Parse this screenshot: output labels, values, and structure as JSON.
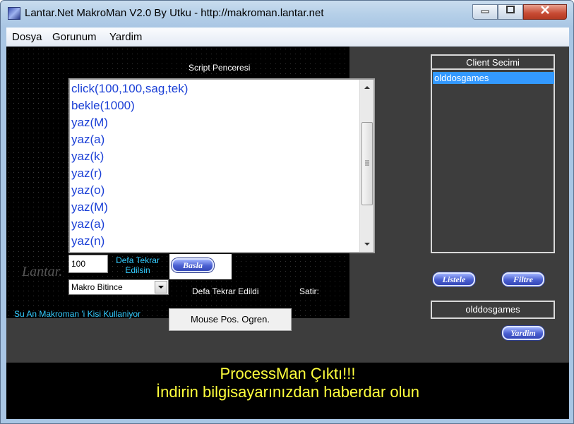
{
  "window": {
    "title": "Lantar.Net MakroMan V2.0 By Utku - http://makroman.lantar.net"
  },
  "menu": [
    "Dosya",
    "Gorunum",
    "Yardim"
  ],
  "script": {
    "heading": "Script Penceresi",
    "lines": [
      "click(100,100,sag,tek)",
      "bekle(1000)",
      "yaz(M)",
      "yaz(a)",
      "yaz(k)",
      "yaz(r)",
      "yaz(o)",
      "yaz(M)",
      "yaz(a)",
      "yaz(n)"
    ]
  },
  "controls": {
    "repeat_value": "100",
    "repeat_label_1": "Defa Tekrar",
    "repeat_label_2": "Edilsin",
    "start_button": "Basla",
    "after_macro_select": "Makro Bitince",
    "repeated_label": "Defa Tekrar Edildi",
    "line_label": "Satir:",
    "users_label": "Su An Makroman 'i Kisi Kullaniyor",
    "mouse_button": "Mouse Pos. Ogren.",
    "watermark": "Lantar."
  },
  "client": {
    "heading": "Client Secimi",
    "selected": "olddosgames",
    "list_button": "Listele",
    "filter_button": "Filtre",
    "current": "olddosgames",
    "help_button": "Yardim"
  },
  "banner": {
    "line1": "ProcessMan Çıktı!!!",
    "line2": "İndirin bilgisayarınızdan haberdar olun"
  },
  "colors": {
    "client_bg": "#3d3d3d",
    "script_text": "#1a3fd6",
    "label_cyan": "#33ccff",
    "banner_text": "#ffff3c",
    "selection": "#3399ff"
  }
}
